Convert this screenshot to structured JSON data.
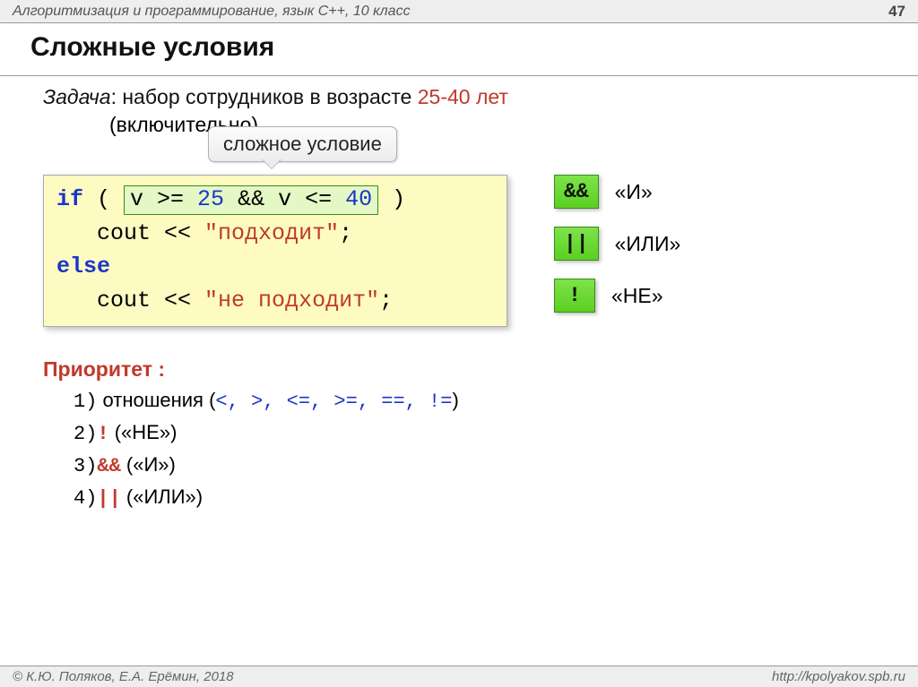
{
  "header": {
    "title": "Алгоритмизация и программирование, язык  C++, 10 класс",
    "page": "47"
  },
  "title": "Сложные условия",
  "task": {
    "label": "Задача",
    "text_before": ": набор сотрудников в возрасте ",
    "accent": "25-40 лет",
    "line2": "(включительно)."
  },
  "callout": "сложное условие",
  "code": {
    "if_kw": "if",
    "paren_open": " ( ",
    "cond": "v >= 25 && v <= 40",
    "paren_close": " )",
    "cout1_prefix": "cout << ",
    "cout1_str": "\"подходит\"",
    "semi": ";",
    "else_kw": "else",
    "cout2_prefix": "cout << ",
    "cout2_str": "\"не подходит\""
  },
  "legend": [
    {
      "sym": "&&",
      "label": "«И»"
    },
    {
      "sym": "||",
      "label": "«ИЛИ»"
    },
    {
      "sym": "!",
      "label": "«НЕ»"
    }
  ],
  "priority": {
    "title": "Приоритет :",
    "items": [
      {
        "idx": "1)",
        "prefix": " отношения (",
        "ops": "<, >, <=, >=, ==, !=",
        "suffix": ")"
      },
      {
        "idx": "2)",
        "op": "!",
        "label": " («НЕ»)"
      },
      {
        "idx": "3)",
        "op": "&&",
        "label": " («И»)"
      },
      {
        "idx": "4)",
        "op": "||",
        "label": " («ИЛИ»)"
      }
    ]
  },
  "footer": {
    "left": "© К.Ю. Поляков, Е.А. Ерёмин, 2018",
    "right": "http://kpolyakov.spb.ru"
  }
}
